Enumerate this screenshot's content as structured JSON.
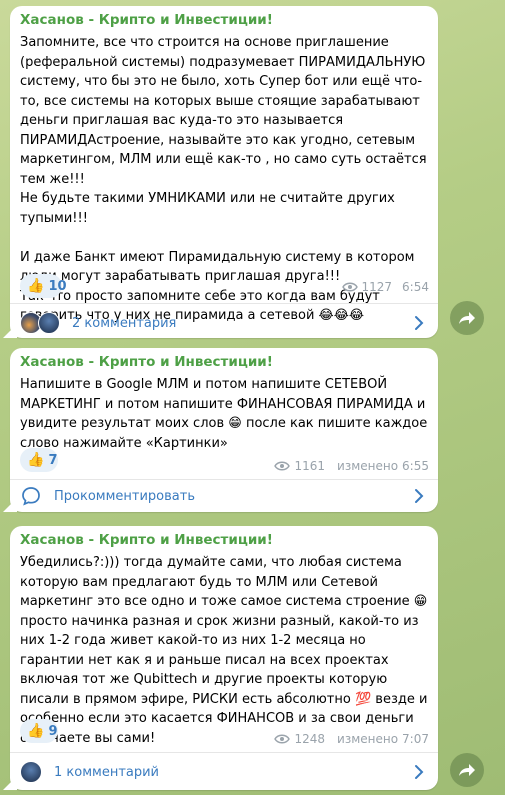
{
  "posts": [
    {
      "author": "Хасанов - Крипто и Инвестиции!",
      "text": "Запомните, все что строится на основе приглашение (реферальной системы) подразумевает ПИРАМИДАЛЬНУЮ систему, что бы это не было, хоть Супер бот или ещё что-то, все системы на которых выше стоящие зарабатывают деньги приглашая вас куда-то это называется ПИРАМИДАстроение, называйте это как угодно, сетевым маркетингом, МЛМ или ещё как-то , но само суть остаётся тем же!!!\nНе будьте такими УМНИКАМИ или не считайте других тупыми!!!\n\nИ даже Банкт имеют Пирамидальную систему в котором люди могут зарабатывать приглашая друга!!!\nТак что просто запомните себе это когда вам будут говорить что у них не пирамида а сетевой 😂😂😂",
      "reaction_emoji": "👍",
      "reaction_count": "10",
      "views": "1127",
      "time": "6:54",
      "edited": "",
      "comments_label": "2 комментария",
      "comment_icon": "avatars"
    },
    {
      "author": "Хасанов - Крипто и Инвестиции!",
      "text": "Напишите в Google МЛМ и потом напишите СЕТЕВОЙ МАРКЕТИНГ и потом напишите ФИНАНСОВАЯ ПИРАМИДА и увидите результат моих слов 😁 после как пишите каждое слово нажимайте «Картинки»",
      "reaction_emoji": "👍",
      "reaction_count": "7",
      "views": "1161",
      "time": "6:55",
      "edited": "изменено",
      "comments_label": "Прокомментировать",
      "comment_icon": "comment-bubble-icon"
    },
    {
      "author": "Хасанов - Крипто и Инвестиции!",
      "text": "Убедились?:))) тогда думайте сами, что любая система которую вам предлагают будь то МЛМ или Сетевой маркетинг это все одно и тоже самое система строение 😁 просто начинка разная и срок жизни разный, какой-то из них 1-2 года живет какой-то из них 1-2 месяца но гарантии нет как я и раньше писал на всех проектах включая тот же Qubittech и другие проекты которую писали в прямом эфире, РИСКИ есть абсолютно 💯 везде и особенно если это касается ФИНАНСОВ и за свои деньги отвечаете вы сами!",
      "reaction_emoji": "👍",
      "reaction_count": "9",
      "views": "1248",
      "time": "7:07",
      "edited": "изменено",
      "comments_label": "1 комментарий",
      "comment_icon": "avatars"
    }
  ],
  "colors": {
    "author": "#4ea046",
    "link": "#3a7bbf",
    "meta": "#9aa3ab",
    "reaction_bg": "#e7f0f8"
  }
}
